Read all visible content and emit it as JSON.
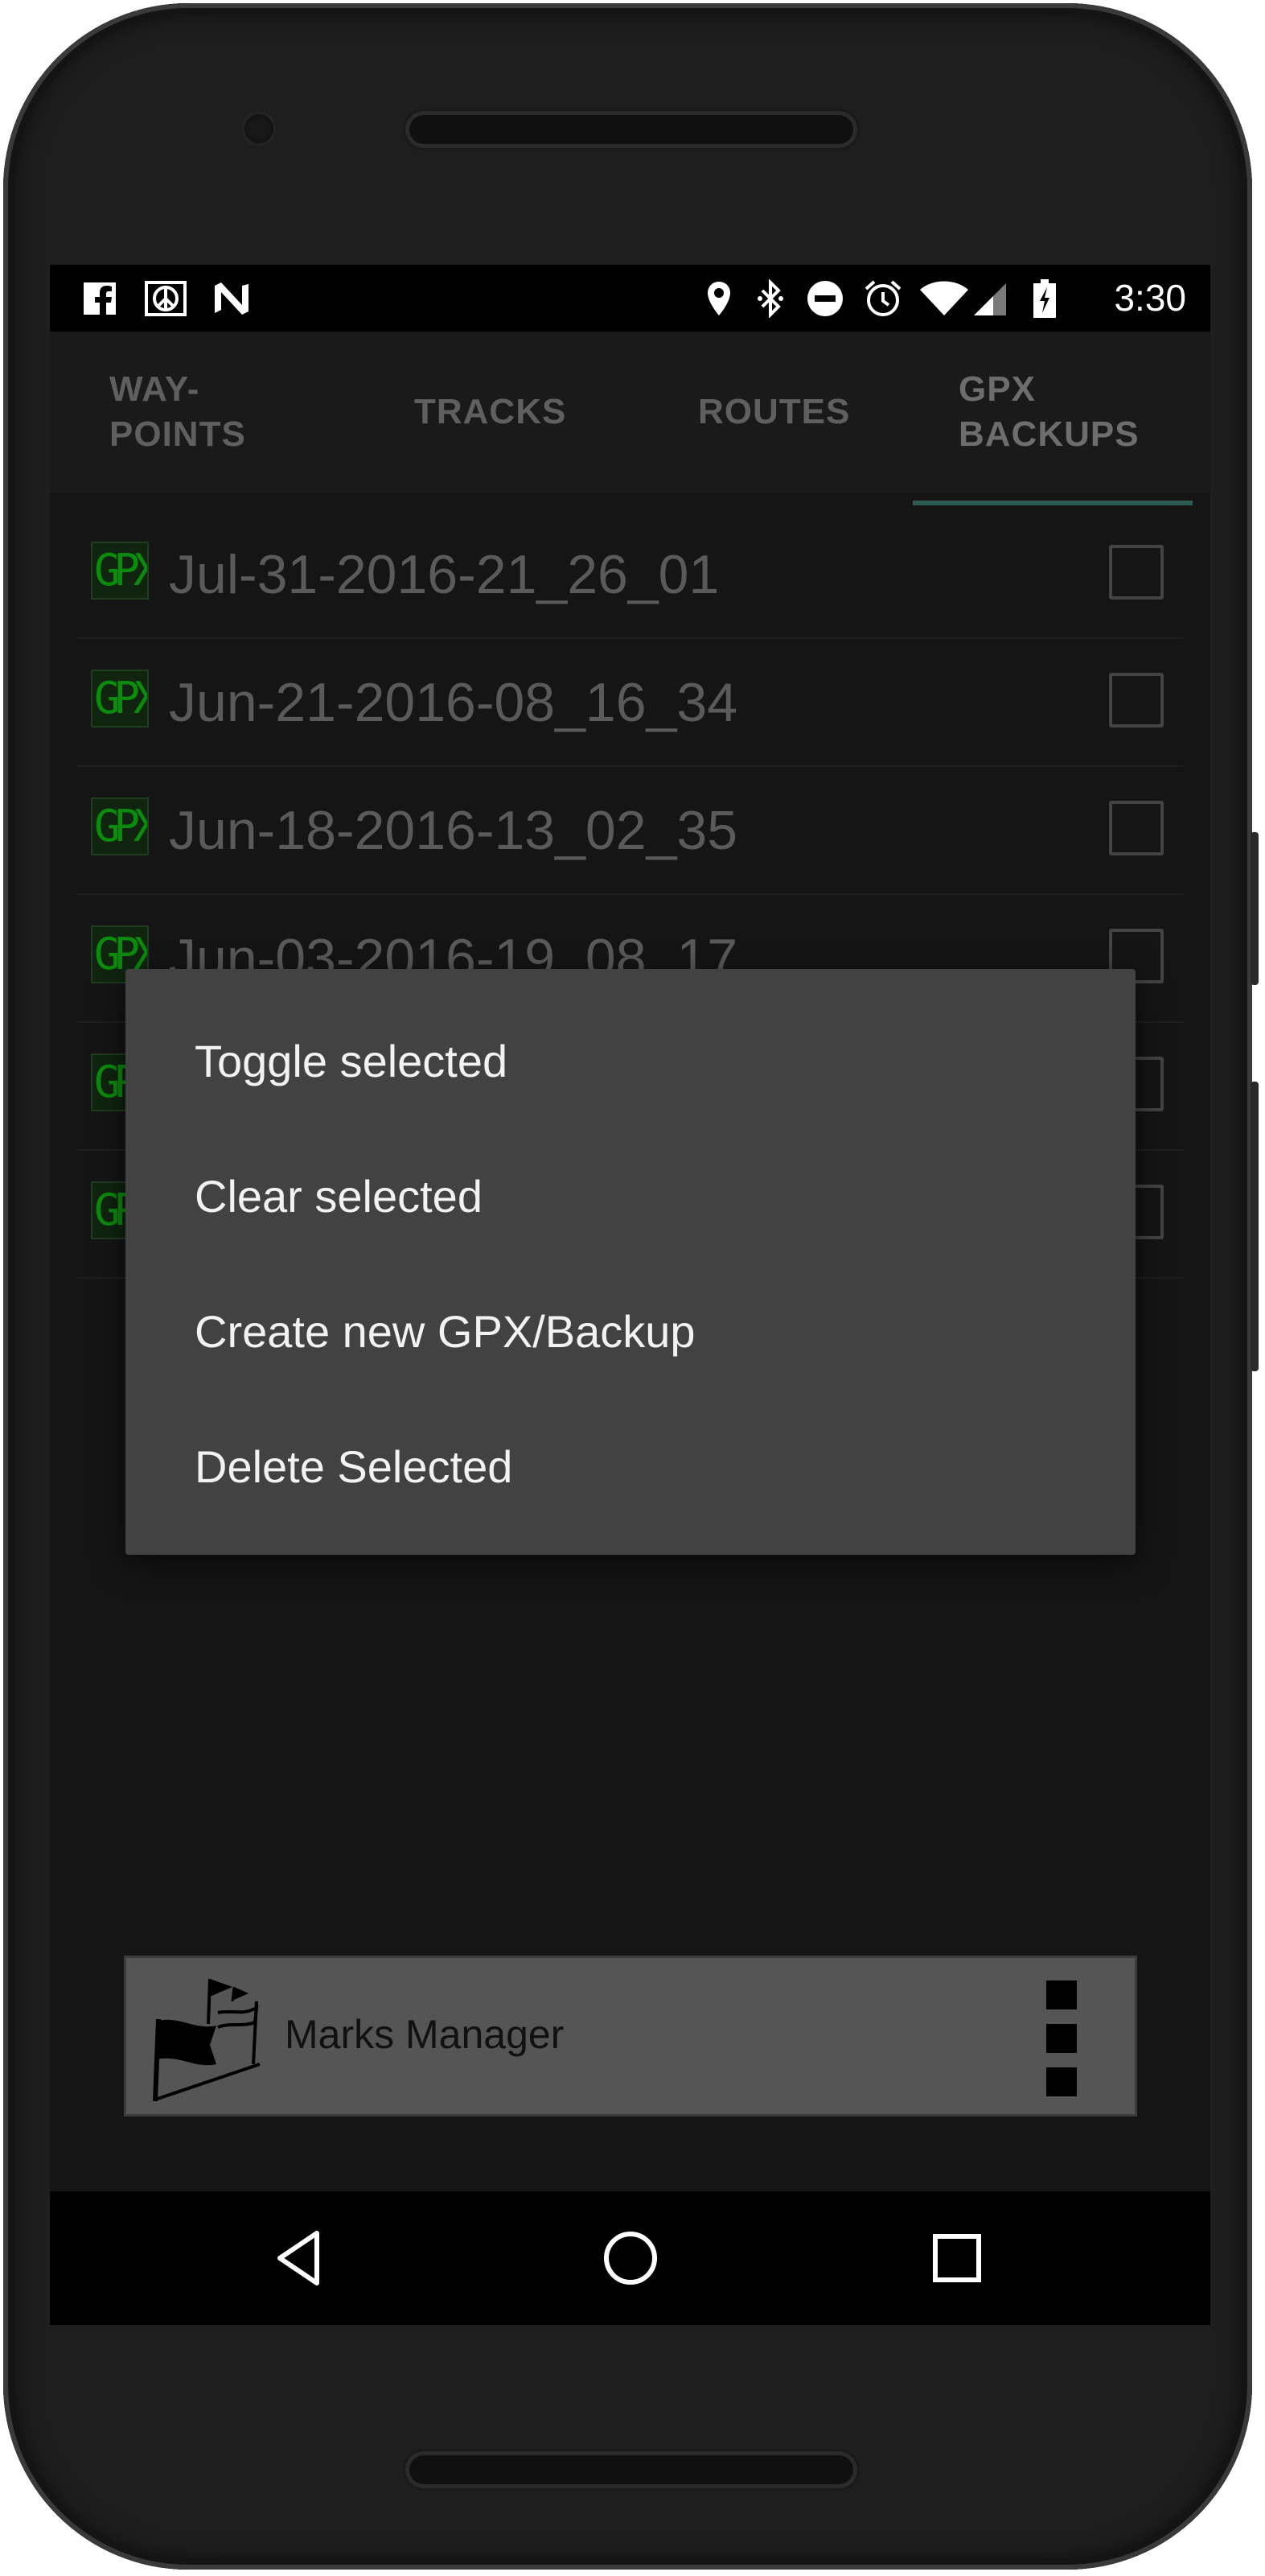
{
  "status_bar": {
    "time": "3:30",
    "left_icons": [
      "facebook-icon",
      "peace-icon",
      "n-icon"
    ],
    "right_icons": [
      "location-icon",
      "bluetooth-icon",
      "do-not-disturb-icon",
      "alarm-icon",
      "wifi-icon",
      "signal-icon",
      "battery-charging-icon"
    ]
  },
  "tabs": [
    {
      "label": "WAY-\nPOINTS",
      "active": false
    },
    {
      "label": "TRACKS",
      "active": false
    },
    {
      "label": "ROUTES",
      "active": false
    },
    {
      "label": "GPX\nBACKUPS",
      "active": true
    }
  ],
  "file_list": {
    "icon_label": "GPX",
    "items": [
      {
        "name": "Jul-31-2016-21_26_01",
        "checked": false
      },
      {
        "name": "Jun-21-2016-08_16_34",
        "checked": false
      },
      {
        "name": "Jun-18-2016-13_02_35",
        "checked": false
      },
      {
        "name": "Jun-03-2016-19_08_17",
        "checked": false
      },
      {
        "name": "",
        "checked": false
      },
      {
        "name": "",
        "checked": false
      }
    ]
  },
  "context_menu": {
    "items": [
      "Toggle selected",
      "Clear selected",
      "Create new GPX/Backup",
      "Delete Selected"
    ]
  },
  "bottom_bar": {
    "title": "Marks Manager",
    "logo_icon": "flags-icon",
    "menu_icon": "overflow-menu-icon"
  },
  "nav_bar": {
    "buttons": [
      "back-icon",
      "home-icon",
      "recents-icon"
    ]
  },
  "colors": {
    "screen_bg": "#151515",
    "tab_indicator": "#2f5c52",
    "menu_bg": "#424242",
    "gpx_icon_text": "#0c8c0c",
    "bottom_bar_bg": "#555555"
  }
}
